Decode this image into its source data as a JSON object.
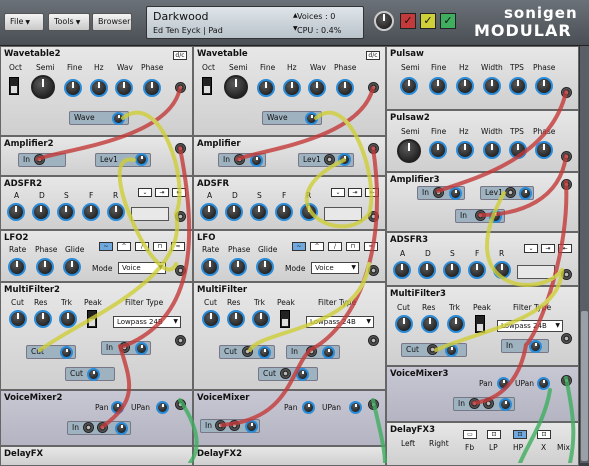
{
  "menu": {
    "file": "File",
    "tools": "Tools",
    "browser": "Browser"
  },
  "preset": {
    "name": "Darkwood",
    "author": "Ed Ten Eyck | Pad",
    "voices": "Voices : 0",
    "cpu": "CPU     : 0.4%"
  },
  "logo": {
    "line1": "sonigen",
    "line2": "MODULAR"
  },
  "colors": {
    "red": "#c43a3a",
    "yellow": "#cfcf3a",
    "green": "#3fae5f",
    "accent": "#2a8bd8"
  },
  "modules": {
    "wt2": {
      "title": "Wavetable2",
      "labels": [
        "Oct",
        "Semi",
        "Fine",
        "Hz",
        "Wav",
        "Phase"
      ],
      "wave": "Wave"
    },
    "wt": {
      "title": "Wavetable",
      "labels": [
        "Oct",
        "Semi",
        "Fine",
        "Hz",
        "Wav",
        "Phase"
      ],
      "wave": "Wave"
    },
    "ps": {
      "title": "Pulsaw",
      "labels": [
        "Semi",
        "Fine",
        "Hz",
        "Width",
        "TPS",
        "Phase"
      ]
    },
    "ps2": {
      "title": "Pulsaw2",
      "labels": [
        "Semi",
        "Fine",
        "Hz",
        "Width",
        "TPS",
        "Phase"
      ]
    },
    "amp2": {
      "title": "Amplifier2",
      "in": "In",
      "lev": "Lev1"
    },
    "amp": {
      "title": "Amplifier",
      "in": "In",
      "lev": "Lev1"
    },
    "amp3": {
      "title": "Amplifier3",
      "in": "In",
      "lev": "Lev1",
      "in2": "In"
    },
    "adsr2": {
      "title": "ADSFR2",
      "labels": [
        "A",
        "D",
        "S",
        "F",
        "R"
      ]
    },
    "adsr": {
      "title": "ADSFR",
      "labels": [
        "A",
        "D",
        "S",
        "F",
        "R"
      ]
    },
    "adsr3": {
      "title": "ADSFR3",
      "labels": [
        "A",
        "D",
        "S",
        "F",
        "R"
      ]
    },
    "lfo2": {
      "title": "LFO2",
      "labels": [
        "Rate",
        "Phase",
        "Glide"
      ],
      "mode": "Mode",
      "modeval": "Voice"
    },
    "lfo": {
      "title": "LFO",
      "labels": [
        "Rate",
        "Phase",
        "Glide"
      ],
      "mode": "Mode",
      "modeval": "Voice"
    },
    "mf2": {
      "title": "MultiFilter2",
      "labels": [
        "Cut",
        "Res",
        "Trk",
        "Peak"
      ],
      "ft": "Filter Type",
      "ftval": "Lowpass 24B",
      "cut": "Cut",
      "in": "In",
      "cut2": "Cut"
    },
    "mf": {
      "title": "MultiFilter",
      "labels": [
        "Cut",
        "Res",
        "Trk",
        "Peak"
      ],
      "ft": "Filter Type",
      "ftval": "Lowpass 24B",
      "cut": "Cut",
      "in": "In",
      "cut2": "Cut"
    },
    "mf3": {
      "title": "MultiFilter3",
      "labels": [
        "Cut",
        "Res",
        "Trk",
        "Peak"
      ],
      "ft": "Filter Type",
      "ftval": "Lowpass 24B",
      "cut": "Cut",
      "in": "In"
    },
    "vm2": {
      "title": "VoiceMixer2",
      "pan": "Pan",
      "upan": "UPan",
      "in": "In"
    },
    "vm": {
      "title": "VoiceMixer",
      "pan": "Pan",
      "upan": "UPan",
      "in": "In"
    },
    "vm3": {
      "title": "VoiceMixer3",
      "pan": "Pan",
      "upan": "UPan",
      "in": "In"
    },
    "dfx": {
      "title": "DelayFX"
    },
    "dfx2": {
      "title": "DelayFX2"
    },
    "dfx3": {
      "title": "DelayFX3",
      "labels": [
        "Left",
        "Right",
        "Fb",
        "LP",
        "HP",
        "X",
        "Mix"
      ]
    }
  }
}
